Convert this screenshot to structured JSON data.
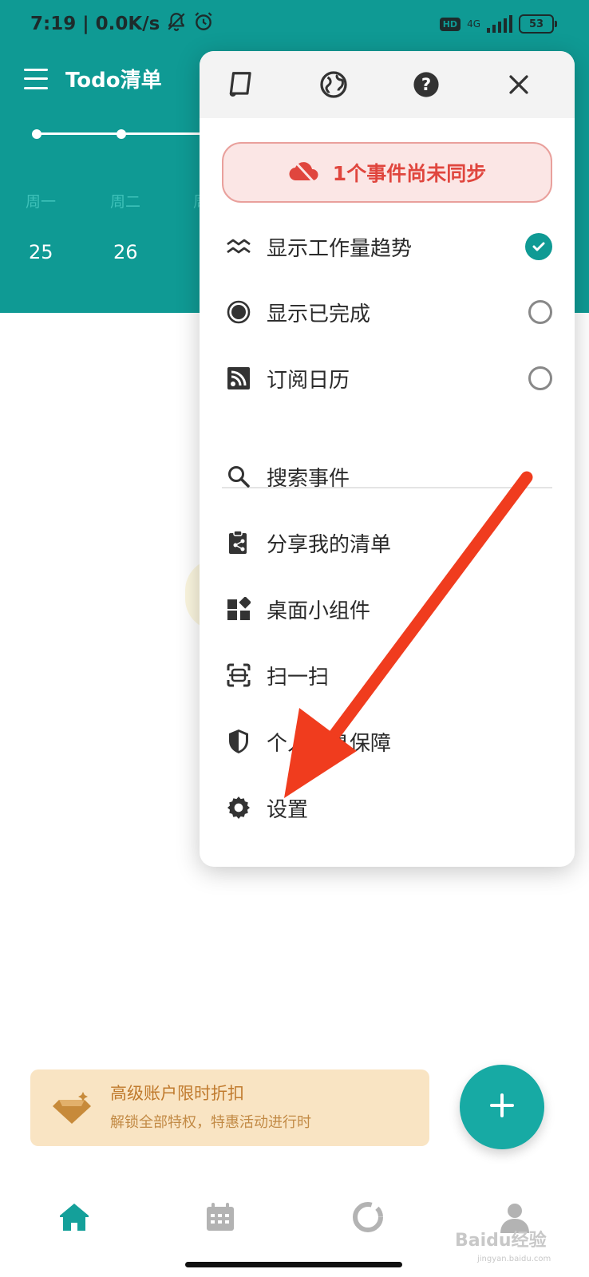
{
  "status_bar": {
    "time_text": "7:19 | 0.0K/s",
    "hd": "HD",
    "network": "4G",
    "battery": "53"
  },
  "app": {
    "title": "Todo清单"
  },
  "week": {
    "days": [
      {
        "weekday": "周一",
        "date": "25"
      },
      {
        "weekday": "周二",
        "date": "26"
      }
    ],
    "partial_weekday": "周"
  },
  "popup": {
    "toolbar_icons": [
      "notes-icon",
      "globe-icon",
      "help-icon",
      "close-icon"
    ],
    "sync_banner": "1个事件尚未同步",
    "toggles": [
      {
        "icon": "workload-trend-icon",
        "label": "显示工作量趋势",
        "checked": true
      },
      {
        "icon": "completed-dot-icon",
        "label": "显示已完成",
        "checked": false
      },
      {
        "icon": "rss-icon",
        "label": "订阅日历",
        "checked": false
      }
    ],
    "actions": [
      {
        "icon": "search-icon",
        "label": "搜索事件"
      },
      {
        "icon": "share-list-icon",
        "label": "分享我的清单"
      },
      {
        "icon": "widgets-icon",
        "label": "桌面小组件"
      },
      {
        "icon": "scan-icon",
        "label": "扫一扫"
      },
      {
        "icon": "privacy-shield-icon",
        "label": "个人信息保障"
      },
      {
        "icon": "gear-icon",
        "label": "设置"
      }
    ]
  },
  "promo": {
    "title": "高级账户限时折扣",
    "subtitle": "解锁全部特权，特惠活动进行时"
  },
  "bottom_nav": [
    "home-icon",
    "calendar-icon",
    "stats-ring-icon",
    "profile-icon"
  ],
  "watermark": {
    "text": "Baidu经验",
    "sub": "jingyan.baidu.com"
  },
  "colors": {
    "brand_teal": "#0f9a94",
    "sync_red": "#e0463e",
    "arrow_red": "#f03c1e",
    "promo_bg": "#f9e4c3"
  }
}
